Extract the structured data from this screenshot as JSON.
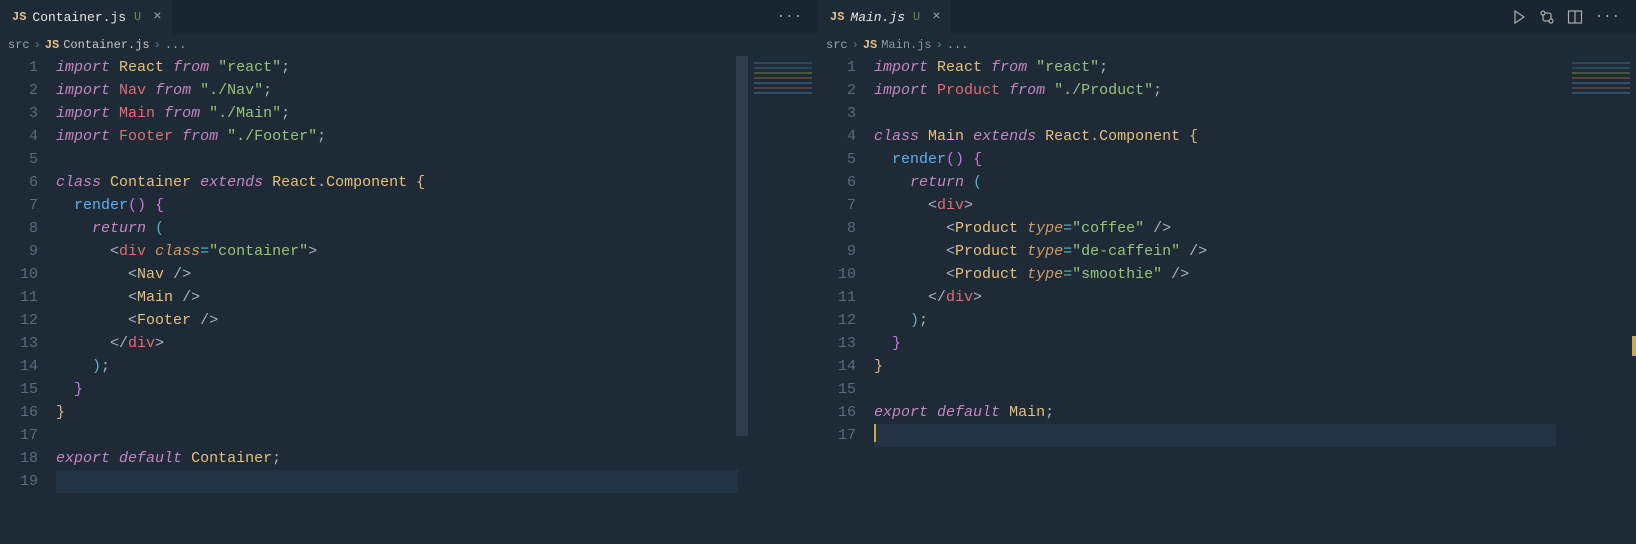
{
  "left": {
    "tab": {
      "icon": "JS",
      "name": "Container.js",
      "git": "U"
    },
    "breadcrumb": {
      "folder": "src",
      "icon": "JS",
      "file": "Container.js",
      "tail": "..."
    },
    "lines": 19,
    "tokens": {
      "l1": {
        "kw": "import",
        "cls": "React",
        "from": "from",
        "str": "\"react\""
      },
      "l2": {
        "kw": "import",
        "var": "Nav",
        "from": "from",
        "str": "\"./Nav\""
      },
      "l3": {
        "kw": "import",
        "var": "Main",
        "from": "from",
        "str": "\"./Main\""
      },
      "l4": {
        "kw": "import",
        "var": "Footer",
        "from": "from",
        "str": "\"./Footer\""
      },
      "l6": {
        "kw": "class",
        "cls": "Container",
        "ext": "extends",
        "r": "React",
        "c": "Component"
      },
      "l7": {
        "fn": "render"
      },
      "l8": {
        "kw": "return"
      },
      "l9": {
        "tag": "div",
        "attr": "class",
        "val": "\"container\""
      },
      "l10": {
        "tag": "Nav"
      },
      "l11": {
        "tag": "Main"
      },
      "l12": {
        "tag": "Footer"
      },
      "l13": {
        "tag": "div"
      },
      "l18": {
        "kw1": "export",
        "kw2": "default",
        "cls": "Container"
      }
    }
  },
  "right": {
    "tab": {
      "icon": "JS",
      "name": "Main.js",
      "git": "U"
    },
    "breadcrumb": {
      "folder": "src",
      "icon": "JS",
      "file": "Main.js",
      "tail": "..."
    },
    "lines": 17,
    "cursor_line": 17,
    "tokens": {
      "l1": {
        "kw": "import",
        "cls": "React",
        "from": "from",
        "str": "\"react\""
      },
      "l2": {
        "kw": "import",
        "var": "Product",
        "from": "from",
        "str": "\"./Product\""
      },
      "l4": {
        "kw": "class",
        "cls": "Main",
        "ext": "extends",
        "r": "React",
        "c": "Component"
      },
      "l5": {
        "fn": "render"
      },
      "l6": {
        "kw": "return"
      },
      "l7": {
        "tag": "div"
      },
      "l8": {
        "tag": "Product",
        "attr": "type",
        "val": "\"coffee\""
      },
      "l9": {
        "tag": "Product",
        "attr": "type",
        "val": "\"de-caffein\""
      },
      "l10": {
        "tag": "Product",
        "attr": "type",
        "val": "\"smoothie\""
      },
      "l11": {
        "tag": "div"
      },
      "l16": {
        "kw1": "export",
        "kw2": "default",
        "cls": "Main"
      }
    }
  }
}
